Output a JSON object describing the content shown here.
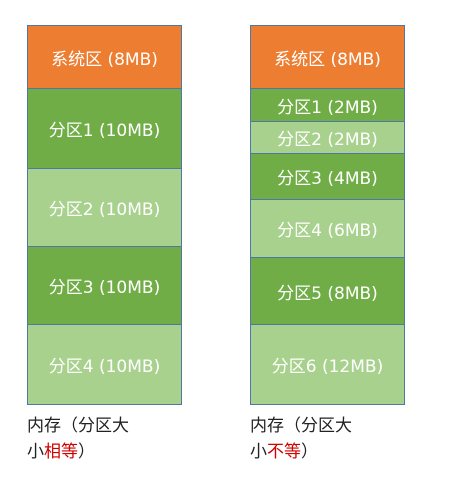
{
  "left": {
    "blocks": [
      {
        "label": "系统区 (8MB)",
        "kind": "system"
      },
      {
        "label": "分区1 (10MB)",
        "kind": "dark"
      },
      {
        "label": "分区2 (10MB)",
        "kind": "light"
      },
      {
        "label": "分区3 (10MB)",
        "kind": "dark"
      },
      {
        "label": "分区4 (10MB)",
        "kind": "light"
      }
    ],
    "caption": {
      "line1": "内存（分区大",
      "prefix": "小",
      "highlight": "相等",
      "suffix": "）"
    }
  },
  "right": {
    "blocks": [
      {
        "label": "系统区 (8MB)",
        "kind": "system"
      },
      {
        "label": "分区1 (2MB)",
        "kind": "dark"
      },
      {
        "label": "分区2 (2MB)",
        "kind": "light"
      },
      {
        "label": "分区3 (4MB)",
        "kind": "dark"
      },
      {
        "label": "分区4 (6MB)",
        "kind": "light"
      },
      {
        "label": "分区5 (8MB)",
        "kind": "dark"
      },
      {
        "label": "分区6 (12MB)",
        "kind": "light"
      }
    ],
    "caption": {
      "line1": "内存（分区大",
      "prefix": "小",
      "highlight": "不等",
      "suffix": "）"
    }
  },
  "colors": {
    "system": "#ed7d31",
    "dark": "#70ad47",
    "light": "#a9d18e",
    "border": "#4e78a6",
    "highlight": "#d00000"
  }
}
